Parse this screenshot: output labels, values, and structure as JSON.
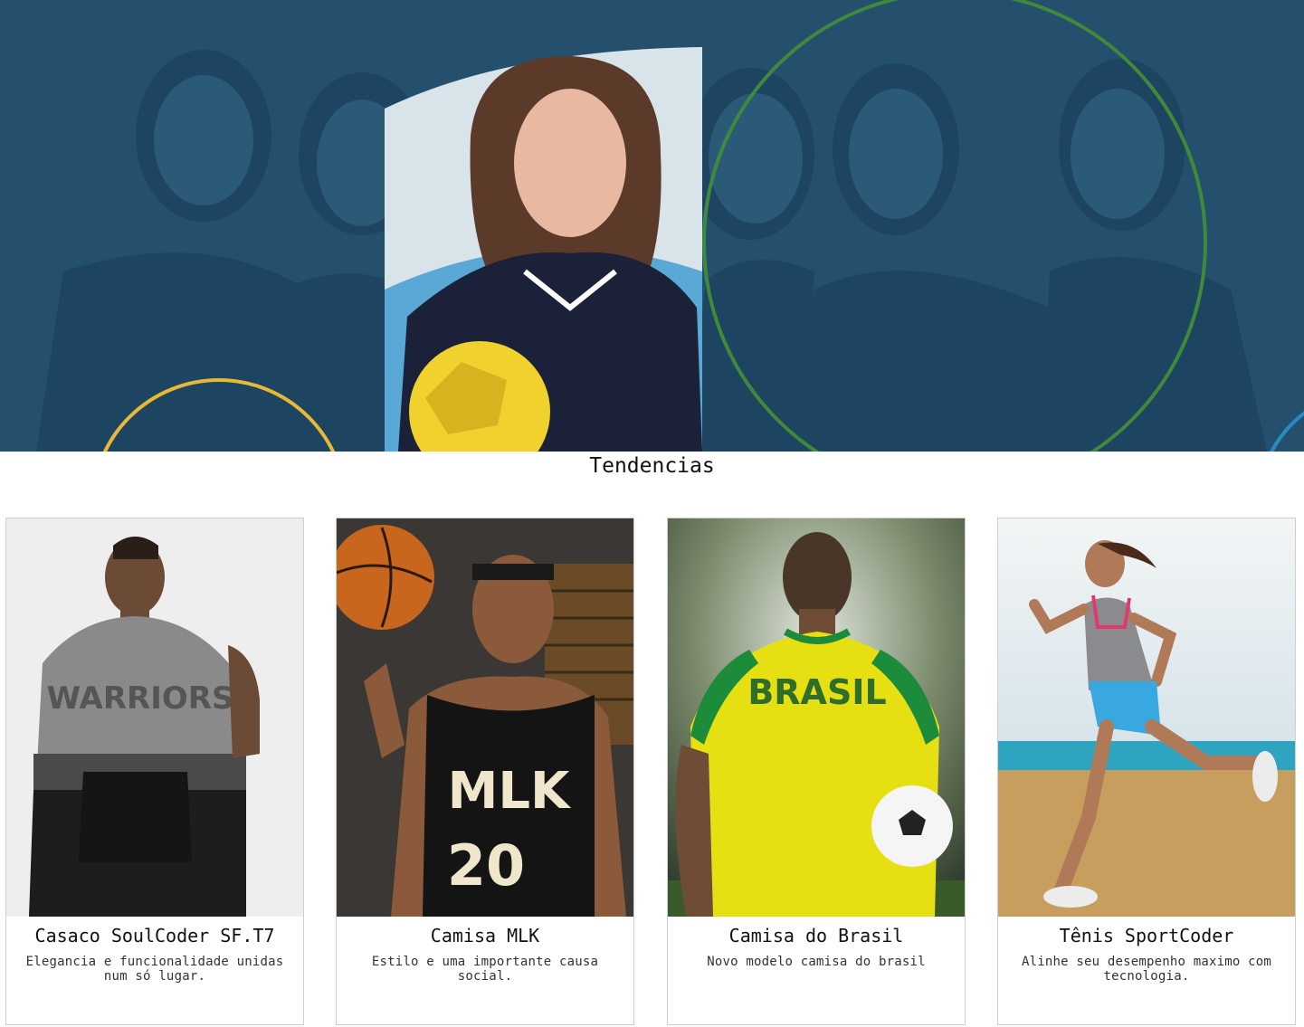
{
  "hero": {
    "image": "women-athletes-team-photo",
    "overlay_color": "#24506e",
    "accent_colors": {
      "yellow": "#e8b936",
      "green": "#3e8a3a",
      "blue": "#2a8ac4"
    }
  },
  "section": {
    "title": "Tendencias"
  },
  "products": [
    {
      "title": "Casaco SoulCoder SF.T7",
      "description": "Elegancia e funcionalidade unidas num só lugar.",
      "image": "man-grey-hoodie-photo"
    },
    {
      "title": "Camisa MLK",
      "description": "Estilo e uma importante causa social.",
      "image": "basketball-player-jersey-photo"
    },
    {
      "title": "Camisa do Brasil",
      "description": "Novo modelo camisa do brasil",
      "image": "brazil-soccer-jersey-photo"
    },
    {
      "title": "Tênis SportCoder",
      "description": "Alinhe seu desempenho maximo com tecnologia.",
      "image": "woman-running-beach-photo"
    }
  ]
}
